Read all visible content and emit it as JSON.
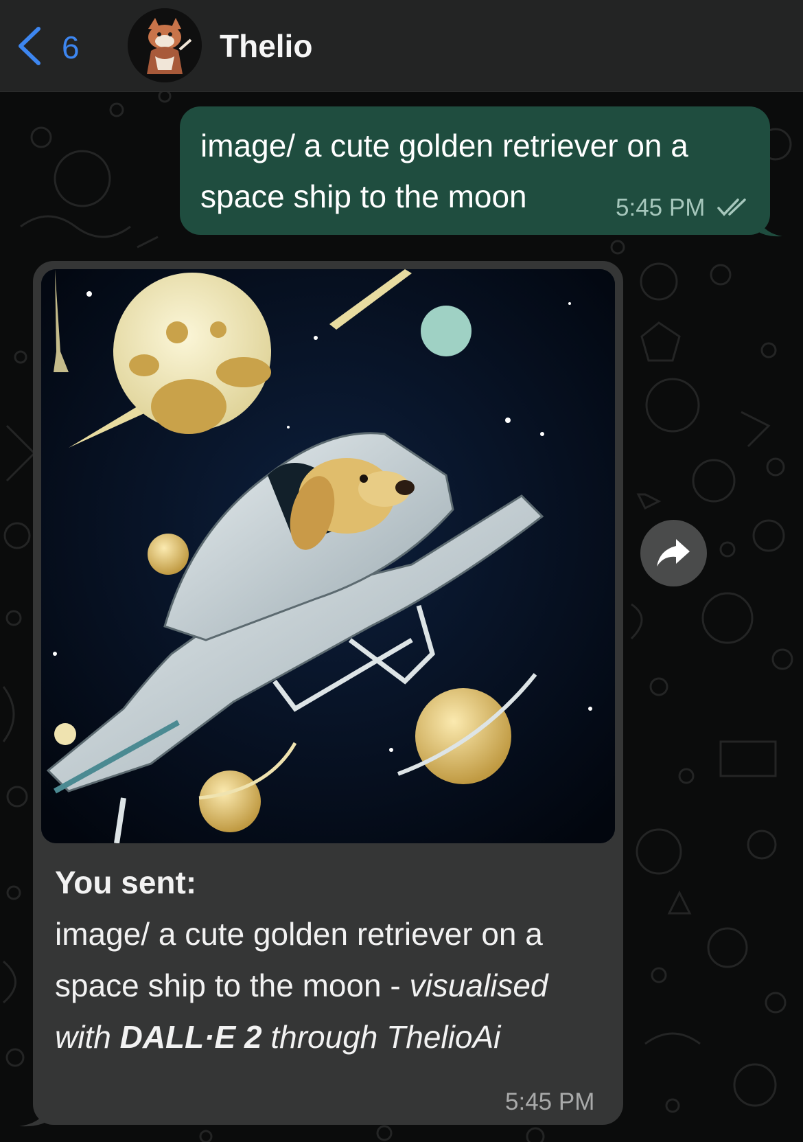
{
  "header": {
    "back_icon": "chevron-left-icon",
    "unread_count": "6",
    "contact_name": "Thelio",
    "avatar_icon": "cartoon-fox-avatar"
  },
  "messages": [
    {
      "direction": "outgoing",
      "text": "image/ a cute golden retriever on a space ship to the moon",
      "time": "5:45 PM",
      "status_icon": "double-check-icon"
    },
    {
      "direction": "incoming",
      "image_icon": "golden-retriever-spaceship-image",
      "caption_label": "You sent:",
      "caption_text": "image/ a cute golden retriever on a space ship to the moon -",
      "credit_prefix": "visualised with",
      "credit_brand": "DALL·E 2",
      "credit_suffix": "through ThelioAi",
      "time": "5:45 PM"
    }
  ],
  "forward_icon": "forward-arrow-icon",
  "colors": {
    "accent": "#3d86f0",
    "outgoing_bubble": "#1f4d3f",
    "incoming_bubble": "#353636",
    "header": "#232424",
    "background": "#0b0c0c"
  }
}
